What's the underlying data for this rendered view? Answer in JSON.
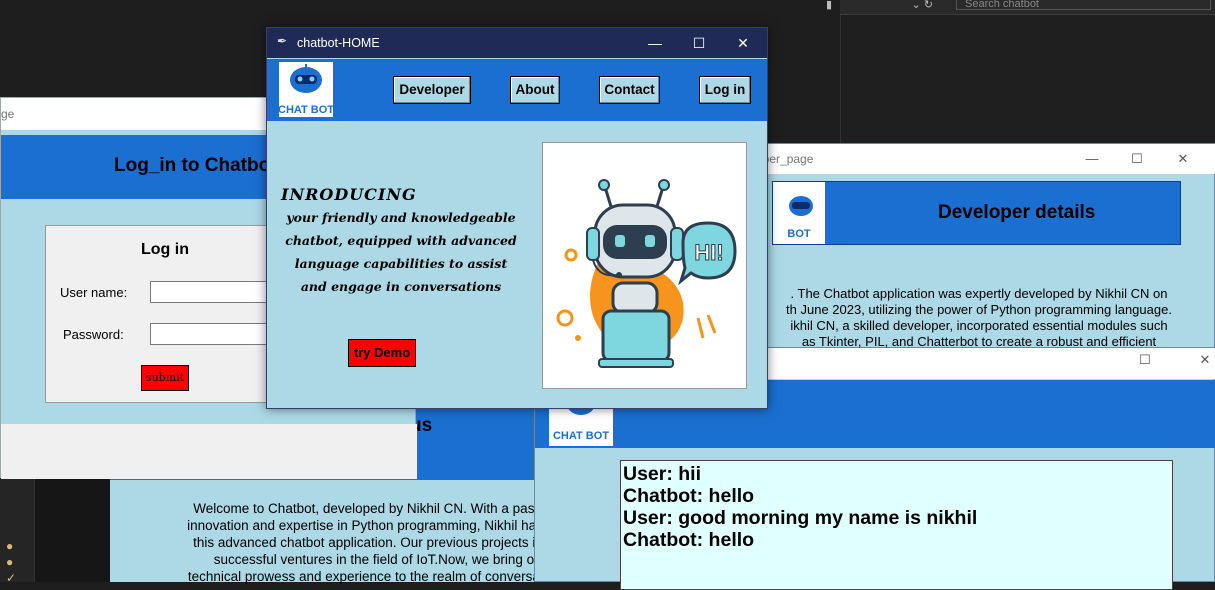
{
  "ide": {
    "search_placeholder": "Search chatbot"
  },
  "about_window": {
    "title_fragment": "us",
    "paragraph": [
      "Welcome to Chatbot, developed by Nikhil CN. With a passion f",
      "innovation and expertise in Python programming, Nikhil has crea",
      "this advanced chatbot application. Our previous projects incluc",
      "successful ventures in the field of IoT.Now, we bring our",
      "technical prowess and experience to the realm of conversational"
    ]
  },
  "chat_window": {
    "logo_text": "CHAT BOT",
    "lines": [
      "User: hii",
      "Chatbot: hello",
      "",
      "User: good morning my name is nikhil",
      "Chatbot: hello"
    ]
  },
  "developer_window": {
    "title": "oper_page",
    "logo_text": "BOT",
    "heading": "Developer details",
    "paragraph": [
      ".  The Chatbot application was expertly developed by Nikhil CN on",
      "th June 2023, utilizing the power of Python programming language.",
      "ikhil CN, a skilled developer, incorporated essential modules such",
      "as Tkinter, PIL, and Chatterbot to create a robust and efficient"
    ]
  },
  "login_window": {
    "title": "ge",
    "heading": "Log_in to Chatbo",
    "panel_title": "Log in",
    "username_label": "User name:",
    "password_label": "Password:",
    "username_value": "",
    "password_value": "",
    "submit_label": "submit"
  },
  "home_window": {
    "title": "chatbot-HOME",
    "logo_text": "CHAT BOT",
    "nav": {
      "developer": "Developer",
      "about": "About",
      "contact": "Contact",
      "login": "Log in"
    },
    "intro_heading": "INRODUCING",
    "intro_lines": [
      "your friendly and knowledgeable",
      "chatbot, equipped with advanced",
      "language capabilities to assist",
      "and engage in conversations"
    ],
    "demo_button": "try Demo",
    "robot_speech": "HI!"
  },
  "colors": {
    "header_blue": "#1a6fd1",
    "light_blue": "#add8e6",
    "chat_bg": "#e0ffff",
    "accent_red": "#ff0000",
    "titlebar_dark": "#1f2a57"
  }
}
